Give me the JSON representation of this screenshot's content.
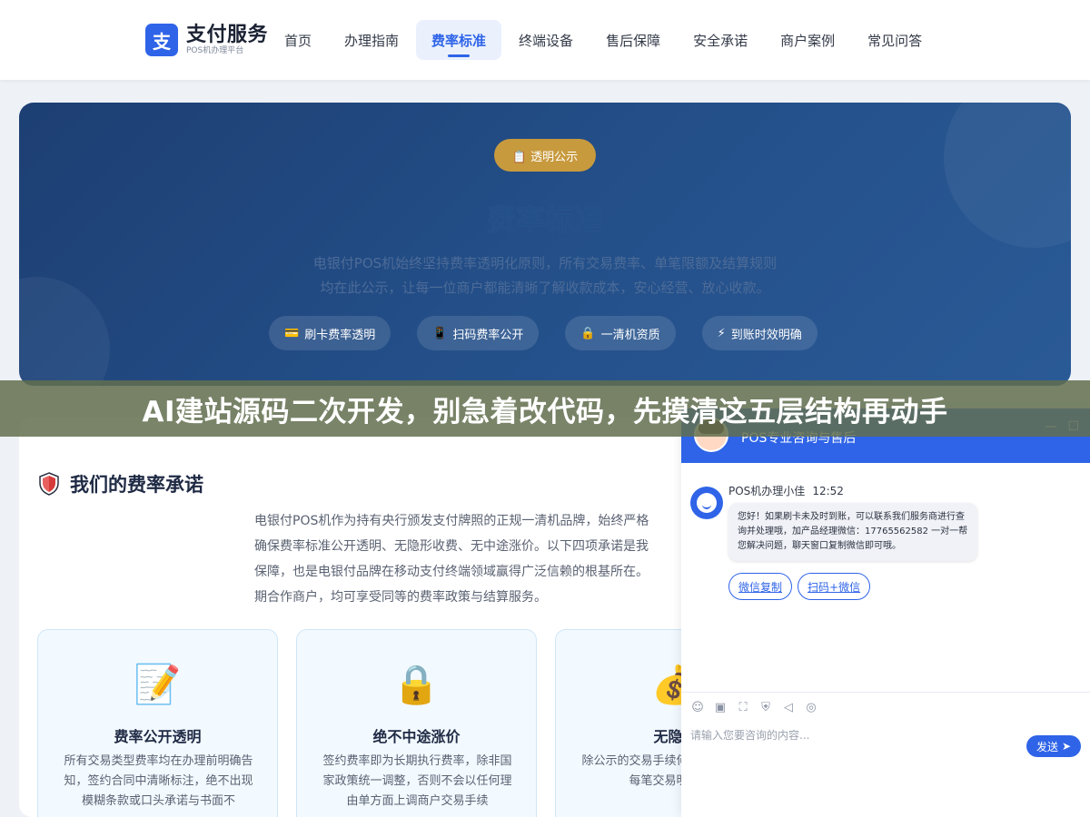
{
  "header": {
    "logo_mark": "支",
    "logo_title": "支付服务",
    "logo_subtitle": "POS机办理平台",
    "nav": [
      {
        "label": "首页",
        "active": false
      },
      {
        "label": "办理指南",
        "active": false
      },
      {
        "label": "费率标准",
        "active": true
      },
      {
        "label": "终端设备",
        "active": false
      },
      {
        "label": "售后保障",
        "active": false
      },
      {
        "label": "安全承诺",
        "active": false
      },
      {
        "label": "商户案例",
        "active": false
      },
      {
        "label": "常见问答",
        "active": false
      }
    ]
  },
  "hero": {
    "badge": "📋 透明公示",
    "title": "费率标准",
    "desc_line1": "电银付POS机始终坚持费率透明化原则，所有交易费率、单笔限额及结算规则",
    "desc_line2": "均在此公示，让每一位商户都能清晰了解收款成本，安心经营、放心收款。",
    "tags": [
      {
        "icon": "💳",
        "label": "刷卡费率透明"
      },
      {
        "icon": "📱",
        "label": "扫码费率公开"
      },
      {
        "icon": "🔒",
        "label": "一清机资质"
      },
      {
        "icon": "⚡",
        "label": "到账时效明确"
      }
    ]
  },
  "banner": {
    "text": "AI建站源码二次开发，别急着改代码，先摸清这五层结构再动手"
  },
  "commitment": {
    "title": "我们的费率承诺",
    "intro_lines": [
      "电银付POS机作为持有央行颁发支付牌照的正规一清机品牌，始终严格",
      "确保费率标准公开透明、无隐形收费、无中途涨价。以下四项承诺是我",
      "保障，也是电银付品牌在移动支付终端领域赢得广泛信赖的根基所在。",
      "期合作商户，均可享受同等的费率政策与结算服务。"
    ],
    "cards": [
      {
        "icon": "📝",
        "title": "费率公开透明",
        "body": "所有交易类型费率均在办理前明确告知，签约合同中清晰标注，绝不出现模糊条款或口头承诺与书面不"
      },
      {
        "icon": "🔒",
        "title": "绝不中途涨价",
        "body": "签约费率即为长期执行费率，除非国家政策统一调整，否则不会以任何理由单方面上调商户交易手续"
      },
      {
        "icon": "💰",
        "title": "无隐形",
        "body": "除公示的交易手续何额外的服务费、每笔交易明细清晰"
      }
    ]
  },
  "chat": {
    "title": "POS专业咨询与售后",
    "min_label": "—",
    "max_label": "☐",
    "agent_name": "POS机办理小佳",
    "time": "12:52",
    "message": "您好！如果刷卡未及时到账，可以联系我们服务商进行查询并处理哦，加产品经理微信：17765562582 一对一帮您解决问题，聊天窗口复制微信即可哦。",
    "quick_replies": [
      "微信复制",
      "扫码+微信"
    ],
    "toolbar_icons": [
      "smile-icon",
      "image-icon",
      "crop-icon",
      "shield-icon",
      "mute-icon",
      "wechat-icon"
    ],
    "input_placeholder": "请输入您要咨询的内容...",
    "send_label": "发送"
  }
}
